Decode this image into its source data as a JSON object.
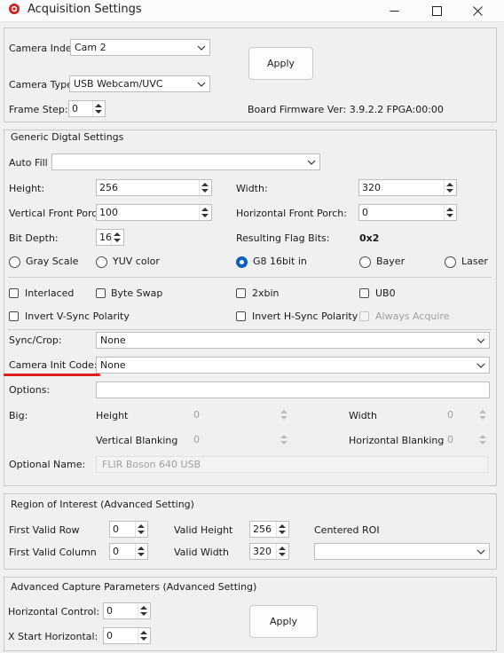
{
  "window": {
    "title": "Acquisition Settings"
  },
  "camera": {
    "index_label": "Camera Index:",
    "index_value": "Cam 2",
    "type_label": "Camera Type:",
    "type_value": "USB Webcam/UVC",
    "frame_step_label": "Frame Step:",
    "frame_step_value": "0",
    "apply_label": "Apply",
    "firmware_text": "Board Firmware Ver: 3.9.2.2 FPGA:00:00"
  },
  "generic": {
    "title": "Generic Digtal Settings",
    "autofill_label": "Auto Fill",
    "autofill_value": "",
    "height_label": "Height:",
    "height_value": "256",
    "width_label": "Width:",
    "width_value": "320",
    "vfp_label": "Vertical Front Porch:",
    "vfp_value": "100",
    "hfp_label": "Horizontal Front Porch:",
    "hfp_value": "0",
    "bitdepth_label": "Bit Depth:",
    "bitdepth_value": "16",
    "flagbits_label": "Resulting Flag Bits:",
    "flagbits_value": "0x2",
    "radios": [
      {
        "label": "Gray Scale",
        "checked": false
      },
      {
        "label": "YUV color",
        "checked": false
      },
      {
        "label": "G8 16bit in",
        "checked": true
      },
      {
        "label": "Bayer",
        "checked": false
      },
      {
        "label": "Laser",
        "checked": false
      }
    ],
    "checks": {
      "interlaced": "Interlaced",
      "byteswap": "Byte Swap",
      "x2bin": "2xbin",
      "ub0": "UB0",
      "invert_v": "Invert V-Sync Polarity",
      "invert_h": "Invert H-Sync Polarity",
      "always_acquire": "Always Acquire"
    },
    "synccrop_label": "Sync/Crop:",
    "synccrop_value": "None",
    "caminit_label": "Camera Init Code:",
    "caminit_value": "None",
    "options_label": "Options:",
    "options_value": "",
    "big_label": "Big:",
    "big_height_label": "Height",
    "big_height_value": "0",
    "big_width_label": "Width",
    "big_width_value": "0",
    "big_vblank_label": "Vertical Blanking",
    "big_vblank_value": "0",
    "big_hblank_label": "Horizontal Blanking",
    "big_hblank_value": "0",
    "optname_label": "Optional Name:",
    "optname_value": "FLIR Boson 640 USB",
    "annotation_color": "#e11c1c"
  },
  "roi": {
    "title": "Region of Interest (Advanced Setting)",
    "fvr_label": "First Valid Row",
    "fvr_value": "0",
    "fvc_label": "First Valid Column",
    "fvc_value": "0",
    "vh_label": "Valid Height",
    "vh_value": "256",
    "vw_label": "Valid Width",
    "vw_value": "320",
    "centered_label": "Centered ROI",
    "centered_value": ""
  },
  "advanced": {
    "title": "Advanced Capture Parameters (Advanced Setting)",
    "hctrl_label": "Horizontal Control:",
    "hctrl_value": "0",
    "xstart_label": "X Start Horizontal:",
    "xstart_value": "0",
    "apply_label": "Apply"
  }
}
